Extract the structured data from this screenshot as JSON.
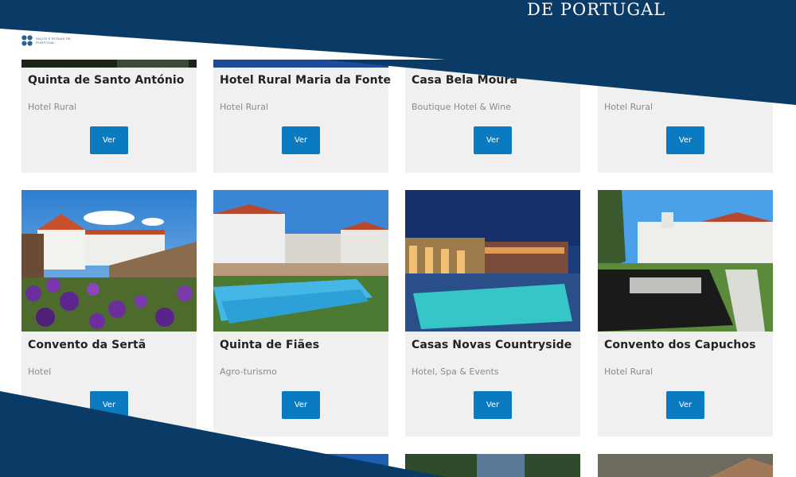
{
  "brand": {
    "header_text": "DE PORTUGAL",
    "logo_text": "PAÇOS E RURAIS DE PORTUGAL"
  },
  "colors": {
    "header_blue": "#0a3a66",
    "button_blue": "#0b7bc1",
    "card_bg": "#f0f0f0"
  },
  "cards": [
    {
      "title": "Quinta de Santo António",
      "type": "Hotel Rural",
      "button": "Ver"
    },
    {
      "title": "Hotel Rural Maria da Fonte",
      "type": "Hotel Rural",
      "button": "Ver"
    },
    {
      "title": "Casa Bela Moura",
      "type": "Boutique Hotel & Wine",
      "button": "Ver"
    },
    {
      "title": "",
      "type": "Hotel Rural",
      "button": "Ver"
    },
    {
      "title": "Convento da Sertã",
      "type": "Hotel",
      "button": "Ver"
    },
    {
      "title": "Quinta de Fiães",
      "type": "Agro-turismo",
      "button": "Ver"
    },
    {
      "title": "Casas Novas Countryside",
      "type": "Hotel, Spa & Events",
      "button": "Ver"
    },
    {
      "title": "Convento dos Capuchos",
      "type": "Hotel Rural",
      "button": "Ver"
    }
  ]
}
